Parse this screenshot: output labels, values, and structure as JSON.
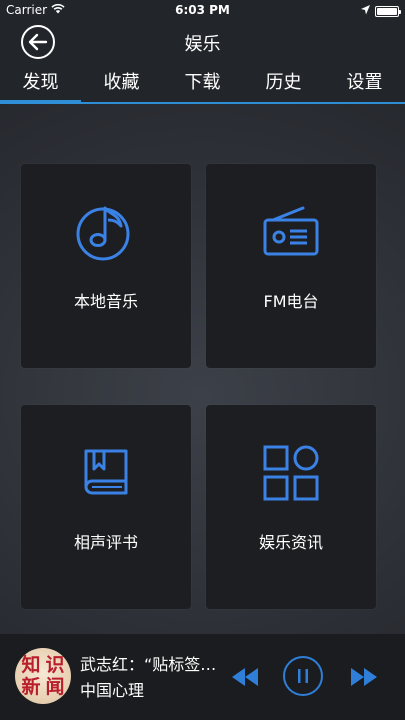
{
  "status_bar": {
    "carrier": "Carrier",
    "time": "6:03 PM",
    "battery_level": 1.0
  },
  "nav": {
    "title": "娱乐",
    "back_icon": "arrow-left-circle-icon"
  },
  "tabs": [
    {
      "label": "发现",
      "active": true
    },
    {
      "label": "收藏",
      "active": false
    },
    {
      "label": "下载",
      "active": false
    },
    {
      "label": "历史",
      "active": false
    },
    {
      "label": "设置",
      "active": false
    }
  ],
  "categories": [
    {
      "label": "本地音乐",
      "icon": "music-note-icon"
    },
    {
      "label": "FM电台",
      "icon": "radio-icon"
    },
    {
      "label": "相声评书",
      "icon": "book-icon"
    },
    {
      "label": "娱乐资讯",
      "icon": "grid-apps-icon"
    }
  ],
  "player": {
    "track_title": "武志红：“贴标签”…",
    "track_subtitle": "中国心理",
    "album_art_text": [
      "知",
      "识",
      "新",
      "闻"
    ],
    "controls": [
      "rewind-icon",
      "pause-icon",
      "fast-forward-icon"
    ]
  },
  "colors": {
    "accent": "#2f8fd6",
    "icon_blue": "#3b82e6",
    "card_bg": "#1d1e21",
    "bar_bg": "#22252a",
    "album_text": "#b81e2b"
  }
}
